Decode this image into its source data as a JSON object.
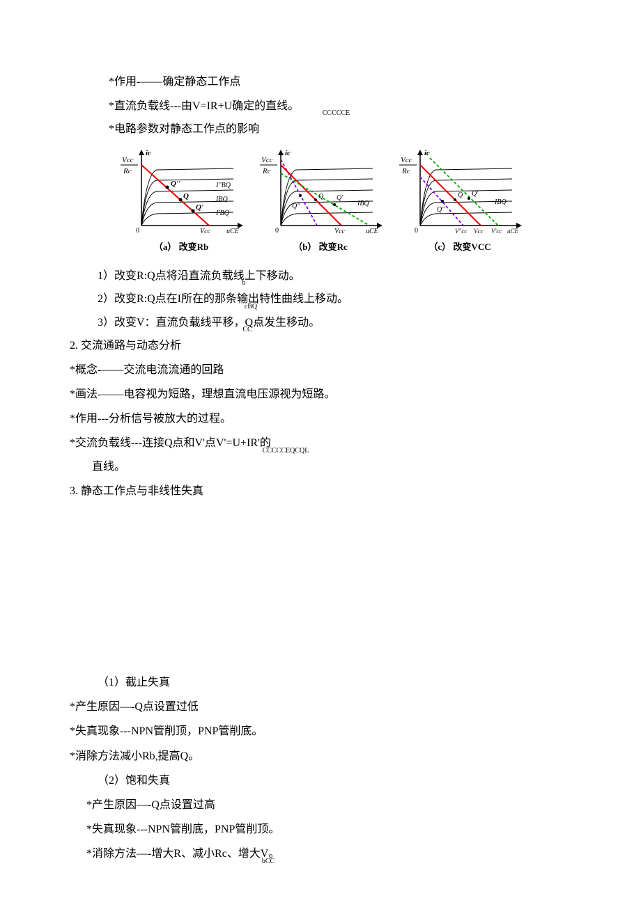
{
  "lines": {
    "l1": "*作用-——确定静态工作点",
    "l2": "*直流负载线---由V=IR+U确定的直线。",
    "l2sub": "CCCCCE",
    "l3": "*电路参数对静态工作点的影响",
    "l4": "1）改变R:Q点将沿直流负载线上下移动。",
    "l4sub": "b",
    "l5": "2）改变R:Q点在I所在的那条输出特性曲线上移动。",
    "l5sub": "cBQ",
    "l6": "3）改变V：直流负载线平移，Q点发生移动。",
    "l6sub": "CC",
    "l7": "2. 交流通路与动态分析",
    "l8": "*概念-——交流电流流通的回路",
    "l9": "*画法-——电容视为短路，理想直流电压源视为短路。",
    "l10": "*作用---分析信号被放大的过程。",
    "l11": "*交流负载线---连接Q点和V'点V'=U+IR'的",
    "l11sub": "CCCCCEQCQL",
    "l12": "直线。",
    "l13": "3. 静态工作点与非线性失真",
    "l14": "（1）截止失真",
    "l15": "*产生原因—-Q点设置过低",
    "l16": "*失真现象---NPN管削顶，PNP管削底。",
    "l17": "*消除方法减小Rb,提高Q。",
    "l18": "（2）饱和失真",
    "l19": "*产生原因—-Q点设置过高",
    "l20": "*失真现象---NPN管削底，PNP管削顶。",
    "l21": "*消除方法—-增大R、减小Rc、增大V。",
    "l21sub": "bCC"
  },
  "diagrams": {
    "a": {
      "caption": "（a） 改变Rb",
      "yaxis_frac_top": "Vcc",
      "yaxis_frac_bot": "Rc",
      "yaxis_label": "ic",
      "xaxis_label_vcc": "Vcc",
      "xaxis_label_uce": "uCE",
      "q": "Q",
      "qp": "Q'",
      "qpp": "Q''",
      "ibq": "IBQ",
      "ibqp": "I'BQ",
      "ibqpp": "I''BQ"
    },
    "b": {
      "caption": "（b） 改变Rc",
      "yaxis_frac_top": "Vcc",
      "yaxis_frac_bot": "Rc",
      "yaxis_label": "ic",
      "xaxis_label_vcc": "Vcc",
      "xaxis_label_uce": "uCE",
      "q": "Q",
      "qp": "Q'",
      "qpp": "Q''",
      "ibq": "IBQ"
    },
    "c": {
      "caption": "（c） 改变VCC",
      "yaxis_frac_top": "Vcc",
      "yaxis_frac_bot": "Rc",
      "yaxis_label": "ic",
      "xaxis_label_uce": "uCE",
      "q": "Q",
      "qp": "Q'",
      "qpp": "Q''",
      "ibq": "IBQ",
      "vcc": "Vcc",
      "vccp": "V'cc",
      "vccpp": "V''cc"
    }
  }
}
